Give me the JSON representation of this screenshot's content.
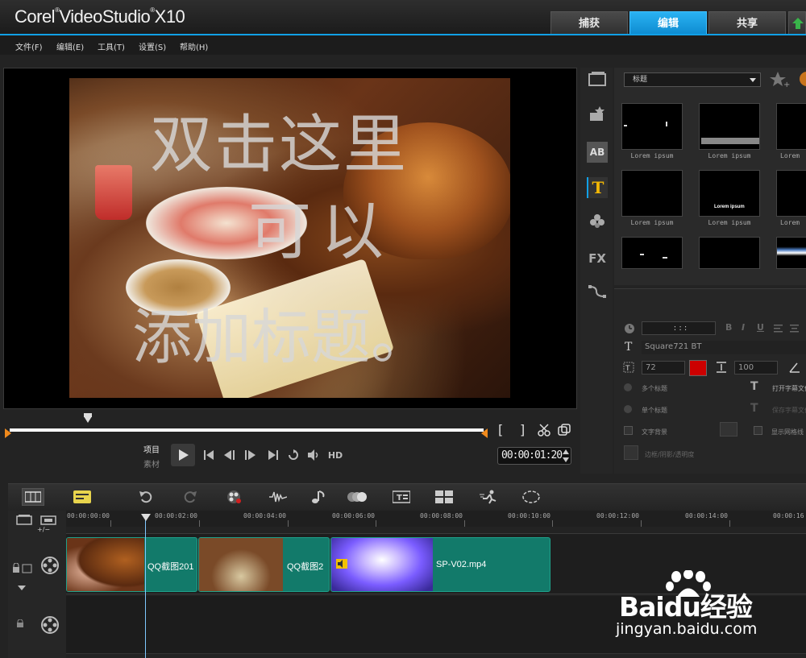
{
  "app": {
    "name": "VideoStudio",
    "brand": "Corel",
    "version": "X10",
    "mode_tabs": [
      "捕获",
      "编辑",
      "共享"
    ],
    "active_tab": "编辑",
    "accent_color": "#11a0e6"
  },
  "menu": [
    "文件(F)",
    "编辑(E)",
    "工具(T)",
    "设置(S)",
    "帮助(H)"
  ],
  "preview": {
    "overlay_lines": [
      "双击这里",
      "可以",
      "添加标题。"
    ]
  },
  "player": {
    "mode_project": "项目",
    "mode_clip": "素材",
    "quality": "HD",
    "timecode": "00:00:01:20",
    "mark_in": "[",
    "mark_out": "]"
  },
  "library": {
    "category": "标题",
    "thumbnails": [
      {
        "label": "Lorem ipsum"
      },
      {
        "label": "Lorem ipsum"
      },
      {
        "label": "Lorem"
      },
      {
        "label": "Lorem ipsum"
      },
      {
        "label": "Lorem ipsum",
        "inner_text": "Lorem ipsum"
      },
      {
        "label": "Lorem"
      },
      {
        "label": ""
      },
      {
        "label": ""
      },
      {
        "label": ""
      }
    ],
    "side_icons": [
      "media-icon",
      "instant-project-icon",
      "transition-icon",
      "title-icon",
      "graphics-icon",
      "fx-filter-icon",
      "path-icon"
    ]
  },
  "options": {
    "duration": ": : :",
    "font": "Square721 BT",
    "font_size": "72",
    "line_spacing": "100",
    "color": "#cc0000",
    "format_buttons": [
      "B",
      "I",
      "U"
    ],
    "open_subtitle": "打开字幕文件",
    "save_subtitle": "保存字幕文件",
    "multi_title": "多个标题",
    "single_title": "单个标题",
    "text_background": "文字背景",
    "show_grid": "显示网格线",
    "border_shadow": "边框/阴影/透明度"
  },
  "timeline": {
    "ruler": [
      "00:00:00:00",
      "00:00:02:00",
      "00:00:04:00",
      "00:00:06:00",
      "00:00:08:00",
      "00:00:10:00",
      "00:00:12:00",
      "00:00:14:00",
      "00:00:16"
    ],
    "add_track": "+/−",
    "clips": [
      {
        "name": "QQ截图201"
      },
      {
        "name": "QQ截图2"
      },
      {
        "name": "SP-V02.mp4"
      }
    ]
  },
  "watermark": {
    "brand": "Baidu经验",
    "url": "jingyan.baidu.com"
  }
}
